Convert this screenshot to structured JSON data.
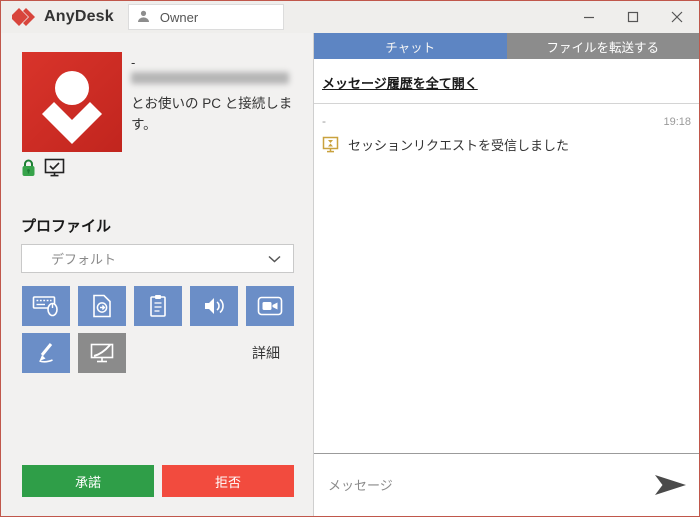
{
  "window": {
    "app_name": "AnyDesk",
    "owner_tab": "Owner"
  },
  "left_panel": {
    "user": {
      "name": "-",
      "id_redacted": true,
      "description": "とお使いの PC と接続します。"
    },
    "status_icons": [
      "lock-icon",
      "monitor-check-icon"
    ],
    "profile": {
      "heading": "プロファイル",
      "selected_option": "デフォルト"
    },
    "permission_icons": [
      "keyboard-mouse-icon",
      "file-transfer-icon",
      "clipboard-icon",
      "audio-icon",
      "record-icon",
      "draw-icon",
      "privacy-mode-icon"
    ],
    "details_label": "詳細",
    "accept_label": "承諾",
    "reject_label": "拒否"
  },
  "right_panel": {
    "tabs": [
      {
        "label": "チャット",
        "active": true
      },
      {
        "label": "ファイルを転送する",
        "active": false
      }
    ],
    "history_link_label": "メッセージ履歴を全て開く",
    "messages": [
      {
        "sender": "-",
        "time": "19:18",
        "icon": "session-request-icon",
        "text": "セッションリクエストを受信しました"
      }
    ],
    "message_input": {
      "placeholder": "メッセージ"
    }
  },
  "colors": {
    "accent_blue": "#5d85c3",
    "button_blue": "#6b8ec7",
    "tab_gray": "#8c8c8c",
    "accept_green": "#2f9e48",
    "reject_red": "#f24b3e",
    "avatar_red": "#d32f28",
    "session_icon_gold": "#c9a23e",
    "window_border": "#c0574b"
  }
}
